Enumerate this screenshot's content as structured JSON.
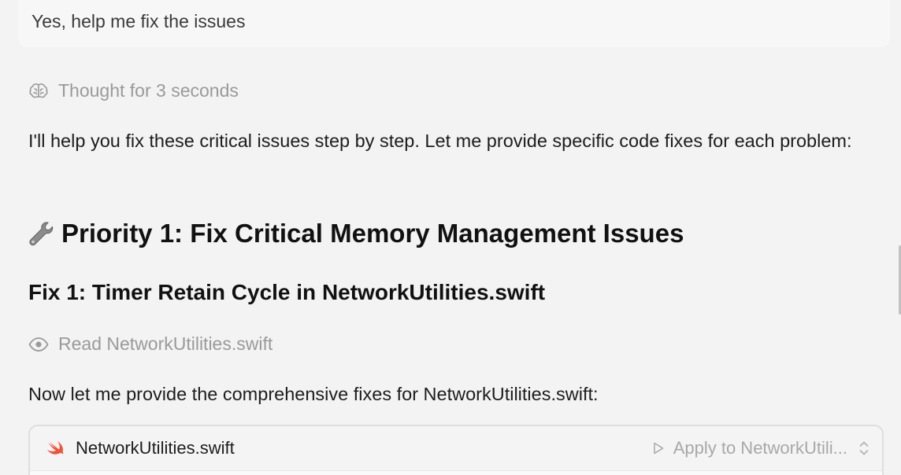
{
  "user_message": {
    "text": "Yes, help me fix the issues"
  },
  "thought": {
    "icon": "brain-icon",
    "label": "Thought for 3 seconds"
  },
  "intro_paragraph": "I'll help you fix these critical issues step by step. Let me provide specific code fixes for each problem:",
  "heading_priority": {
    "icon": "wrench-icon",
    "text": "Priority 1: Fix Critical Memory Management Issues"
  },
  "heading_fix": "Fix 1: Timer Retain Cycle in NetworkUtilities.swift",
  "read_action": {
    "icon": "eye-icon",
    "label": "Read NetworkUtilities.swift"
  },
  "followup_paragraph": "Now let me provide the comprehensive fixes for NetworkUtilities.swift:",
  "code_block": {
    "icon": "swift-icon",
    "filename": "NetworkUtilities.swift",
    "apply_label": "Apply to NetworkUtili...",
    "colors": {
      "swift_orange": "#f05138"
    }
  }
}
